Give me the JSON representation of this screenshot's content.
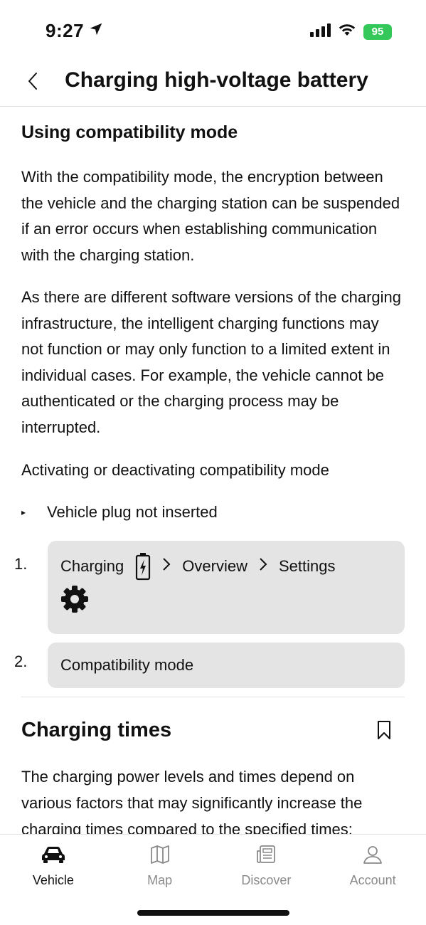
{
  "status": {
    "time": "9:27",
    "battery": "95"
  },
  "header": {
    "title": "Charging high-voltage battery"
  },
  "section1": {
    "title": "Using compatibility mode",
    "para1": "With the compatibility mode, the encryption between the vehicle and the charging station can be suspended if an error occurs when establishing communication with the charging station.",
    "para2": "As there are different software versions of the charging infrastructure, the intelligent charging functions may not function or may only function to a limited extent in individual cases. For example, the vehicle cannot be authenticated or the charging process may be interrupted.",
    "para3": "Activating or deactivating compatibility mode",
    "requirement_marker": "▸",
    "requirement": "Vehicle plug not inserted",
    "steps": [
      {
        "num": "1.",
        "parts": [
          "Charging",
          "Overview",
          "Settings"
        ]
      },
      {
        "num": "2.",
        "text": "Compatibility mode"
      }
    ]
  },
  "section2": {
    "title": "Charging times",
    "para": "The charging power levels and times depend on various factors that may significantly increase the charging times compared to the specified times:"
  },
  "tabbar": {
    "tabs": [
      {
        "label": "Vehicle",
        "icon": "car-icon"
      },
      {
        "label": "Map",
        "icon": "map-icon"
      },
      {
        "label": "Discover",
        "icon": "newspaper-icon"
      },
      {
        "label": "Account",
        "icon": "person-icon"
      }
    ],
    "active": "Vehicle"
  }
}
